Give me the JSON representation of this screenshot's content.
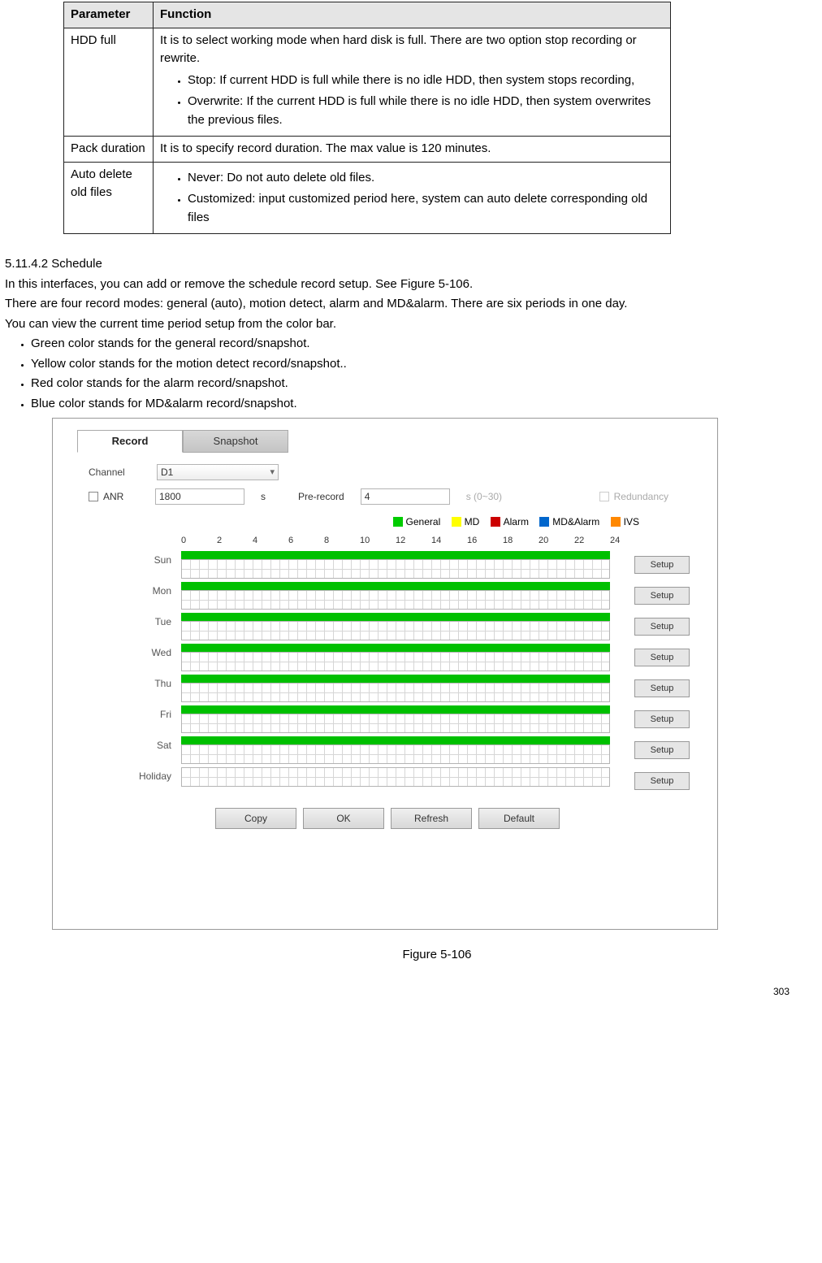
{
  "param_table": {
    "headers": [
      "Parameter",
      "Function"
    ],
    "rows": [
      {
        "param": "HDD full",
        "func_intro": "It is to select working mode when hard disk is full. There are two option stop recording or rewrite.",
        "bullets": [
          "Stop: If current HDD is full while there is no idle HDD, then system stops recording,",
          "Overwrite: If the current HDD is full while there is no idle HDD, then system overwrites the previous files."
        ]
      },
      {
        "param": "Pack duration",
        "func_intro": "It is to specify record duration. The max value is 120 minutes.",
        "bullets": []
      },
      {
        "param": "Auto delete old files",
        "func_intro": "",
        "bullets": [
          "Never: Do not auto delete old files.",
          "Customized: input customized period here, system can auto delete corresponding old files"
        ]
      }
    ]
  },
  "section": {
    "num": "5.11.4.2 Schedule",
    "p1": "In this interfaces, you can add or remove the schedule record setup. See Figure 5-106.",
    "p2": "There are four record modes: general (auto), motion detect, alarm and MD&alarm. There are six periods in one day.",
    "p3": "You can view the current time period setup from the color bar.",
    "bullets": [
      "Green color stands for the general record/snapshot.",
      "Yellow color stands for the motion detect record/snapshot..",
      "Red color stands for the alarm record/snapshot.",
      "Blue color stands for MD&alarm record/snapshot."
    ]
  },
  "figure": {
    "tabs": {
      "active": "Record",
      "other": "Snapshot"
    },
    "controls": {
      "channel_label": "Channel",
      "channel_value": "D1",
      "anr_label": "ANR",
      "anr_value": "1800",
      "anr_unit": "s",
      "prerecord_label": "Pre-record",
      "prerecord_value": "4",
      "prerecord_range": "s (0~30)",
      "redundancy": "Redundancy"
    },
    "legend": [
      {
        "label": "General",
        "class": "sw-gen"
      },
      {
        "label": "MD",
        "class": "sw-md"
      },
      {
        "label": "Alarm",
        "class": "sw-alarm"
      },
      {
        "label": "MD&Alarm",
        "class": "sw-mdalarm"
      },
      {
        "label": "IVS",
        "class": "sw-ivs"
      }
    ],
    "ticks": [
      "0",
      "2",
      "4",
      "6",
      "8",
      "10",
      "12",
      "14",
      "16",
      "18",
      "20",
      "22",
      "24"
    ],
    "days": [
      "Sun",
      "Mon",
      "Tue",
      "Wed",
      "Thu",
      "Fri",
      "Sat",
      "Holiday"
    ],
    "setup_label": "Setup",
    "foot_buttons": [
      "Copy",
      "OK",
      "Refresh",
      "Default"
    ],
    "caption": "Figure 5-106"
  },
  "page_num": "303"
}
